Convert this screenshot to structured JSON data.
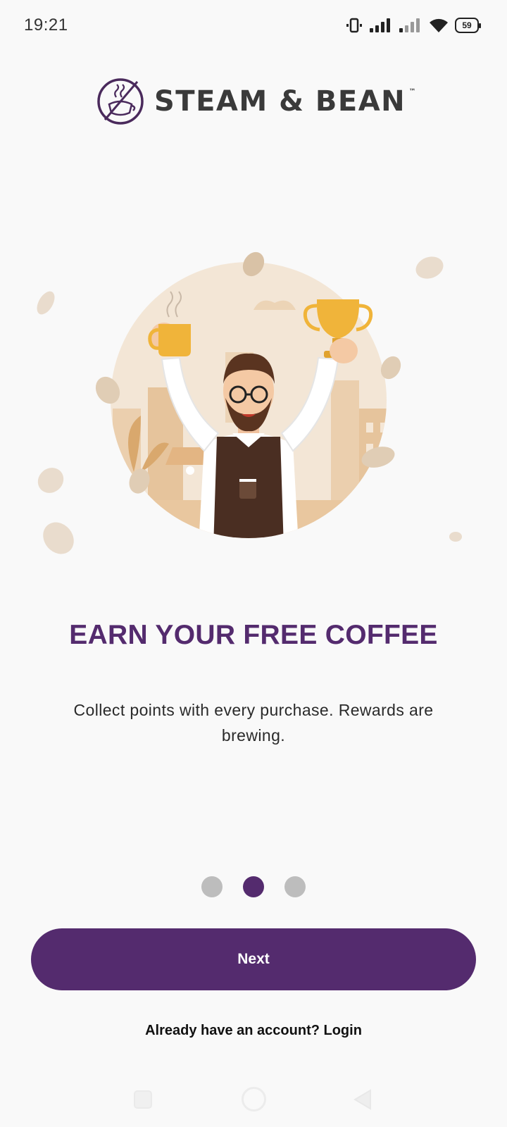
{
  "status_bar": {
    "time": "19:21",
    "battery_level": "59",
    "icons": [
      "vibrate-icon",
      "signal-icon",
      "signal-icon",
      "wifi-icon",
      "battery-icon"
    ]
  },
  "brand": {
    "name": "STEAM & BEAN",
    "trademark": "™",
    "color": "#542b6e"
  },
  "onboarding": {
    "title": "EARN YOUR FREE COFFEE",
    "subtitle": "Collect points with every purchase. Rewards are brewing.",
    "pages_total": 3,
    "current_page": 2
  },
  "actions": {
    "next_label": "Next",
    "login_prompt": "Already have an account? Login"
  },
  "colors": {
    "accent": "#542b6e",
    "dot_inactive": "#bdbdbd",
    "background": "#f9f9f9"
  }
}
